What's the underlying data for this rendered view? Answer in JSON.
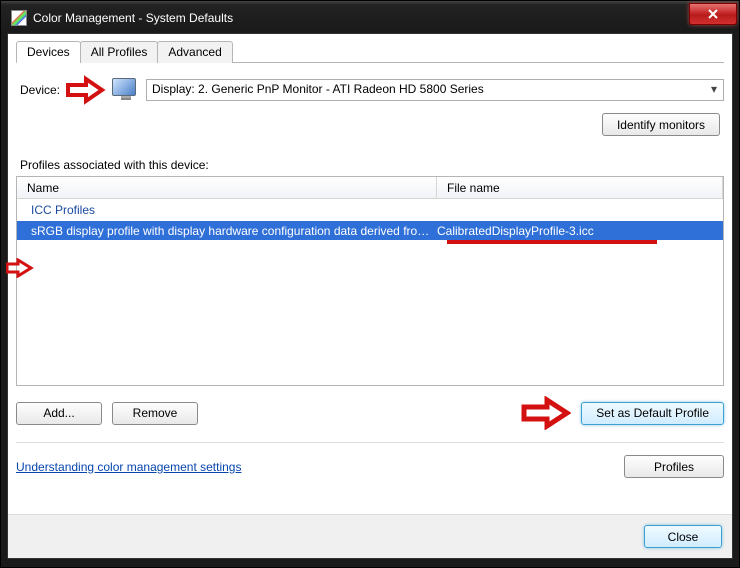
{
  "window": {
    "title": "Color Management - System Defaults",
    "close_tooltip": "Close"
  },
  "tabs": {
    "devices": "Devices",
    "all_profiles": "All Profiles",
    "advanced": "Advanced"
  },
  "device": {
    "label": "Device:",
    "selected": "Display: 2. Generic PnP Monitor - ATI Radeon HD 5800 Series",
    "identify_button": "Identify monitors"
  },
  "profiles_section": {
    "label": "Profiles associated with this device:",
    "columns": {
      "name": "Name",
      "file": "File name"
    },
    "group_header": "ICC Profiles",
    "rows": [
      {
        "name": "sRGB display profile with display hardware configuration data derived from cali...",
        "file": "CalibratedDisplayProfile-3.icc"
      }
    ]
  },
  "buttons": {
    "add": "Add...",
    "remove": "Remove",
    "set_default": "Set as Default Profile",
    "profiles": "Profiles",
    "close": "Close"
  },
  "link": {
    "understanding": "Understanding color management settings"
  }
}
